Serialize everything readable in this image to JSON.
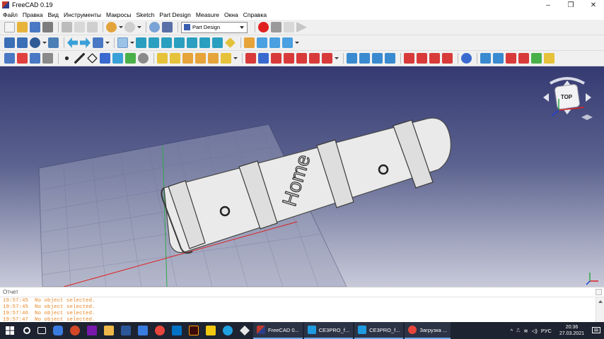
{
  "window": {
    "title": "FreeCAD 0.19",
    "minimize": "–",
    "maximize": "❐",
    "close": "✕"
  },
  "menu": [
    "Файл",
    "Правка",
    "Вид",
    "Инструменты",
    "Макросы",
    "Sketch",
    "Part Design",
    "Measure",
    "Окна",
    "Справка"
  ],
  "toolbar": {
    "workbench": "Part Design"
  },
  "view3d": {
    "model_text": "Home",
    "navcube_face": "TOP"
  },
  "report": {
    "title": "Отчет",
    "lines": [
      "19:57:45  No object selected.",
      "19:57:45  No object selected.",
      "19:57:46  No object selected.",
      "19:57:47  No object selected."
    ]
  },
  "taskbar": {
    "tasks": [
      "FreeCAD 0...",
      "CE3PRO_f...",
      "CE3PRO_f...",
      "Загрузка ..."
    ],
    "language": "РУС",
    "time": "20:36",
    "date": "27.03.2021"
  },
  "colors": {
    "accent_red": "#e02020",
    "background_top": "#353a72",
    "background_bottom": "#c8cad9",
    "log_text": "#e8892a"
  }
}
